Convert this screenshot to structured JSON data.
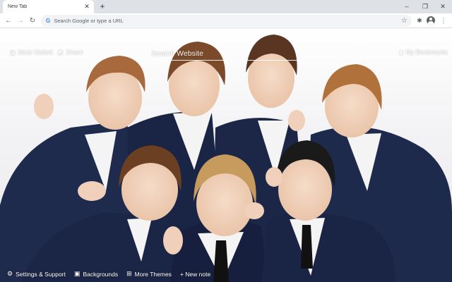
{
  "browser": {
    "tab_title": "New Tab",
    "tab_close_icon": "✕",
    "new_tab_icon": "+",
    "window_controls": [
      "–",
      "❐",
      "✕"
    ],
    "omnibox_placeholder": "Search Google or type a URL",
    "google_icon": "G",
    "nav_icons": {
      "back": "←",
      "forward": "→",
      "reload": "↻"
    },
    "star_icon": "☆",
    "extensions_icon": "✱",
    "menu_icon": "⋮"
  },
  "newtab": {
    "most_visited": "Most Visited",
    "share": "Share",
    "search_placeholder": "Search Website",
    "my_bookmarks": "My Bookmarks",
    "bottom_links": {
      "settings": "Settings & Support",
      "backgrounds": "Backgrounds",
      "more_themes": "More Themes",
      "new_note": "+ New note"
    }
  },
  "colors": {
    "tabstrip": "#dee1e6",
    "omnibox": "#f1f3f4",
    "suit": "#1e2a4a",
    "shirt": "#f4f4f4"
  }
}
